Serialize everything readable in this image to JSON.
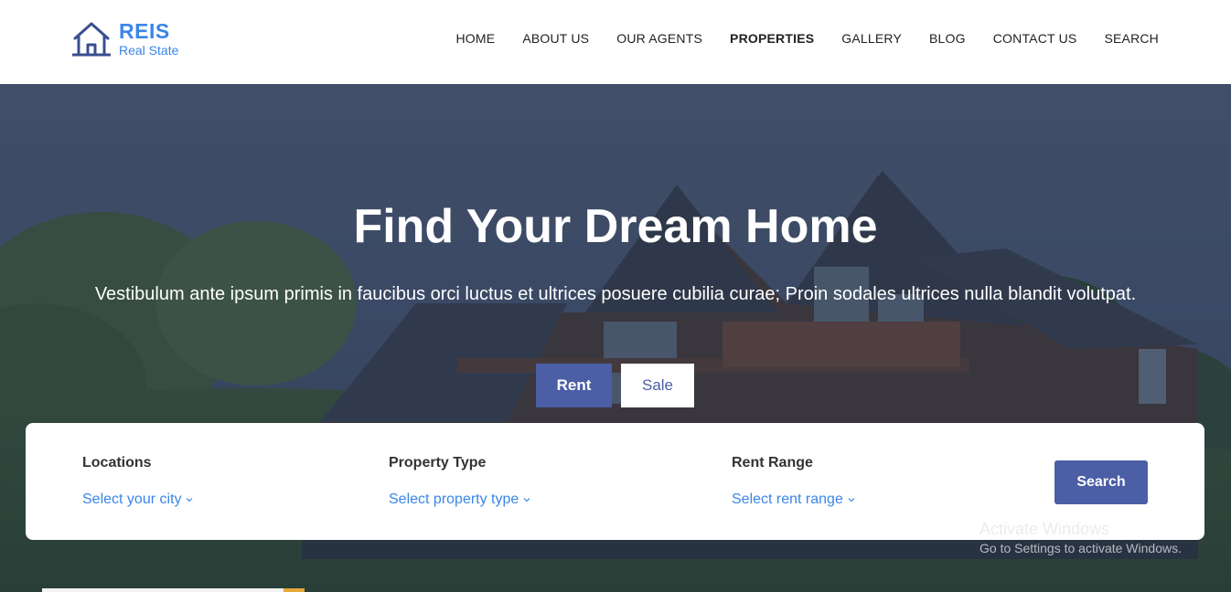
{
  "brand": {
    "name": "REIS",
    "tagline": "Real State",
    "icon": "house-icon"
  },
  "nav": {
    "items": [
      {
        "label": "HOME",
        "active": false
      },
      {
        "label": "ABOUT US",
        "active": false
      },
      {
        "label": "OUR AGENTS",
        "active": false
      },
      {
        "label": "PROPERTIES",
        "active": true
      },
      {
        "label": "GALLERY",
        "active": false
      },
      {
        "label": "BLOG",
        "active": false
      },
      {
        "label": "CONTACT US",
        "active": false
      },
      {
        "label": "SEARCH",
        "active": false
      }
    ]
  },
  "hero": {
    "title": "Find Your Dream Home",
    "subtitle": "Vestibulum ante ipsum primis in faucibus orci luctus et ultrices posuere cubilia curae; Proin sodales ultrices nulla blandit volutpat.",
    "tabs": {
      "rent": "Rent",
      "sale": "Sale",
      "selected": "Rent"
    }
  },
  "search": {
    "locations": {
      "label": "Locations",
      "value": "Select your city"
    },
    "property_type": {
      "label": "Property Type",
      "value": "Select property type"
    },
    "rent_range": {
      "label": "Rent Range",
      "value": "Select rent range"
    },
    "button": "Search"
  },
  "watermark": {
    "title": "Activate Windows",
    "subtitle": "Go to Settings to activate Windows."
  },
  "colors": {
    "brand_blue": "#3a86e8",
    "accent_indigo": "#4b5ea6",
    "hero_overlay": "#2b3a5a"
  }
}
